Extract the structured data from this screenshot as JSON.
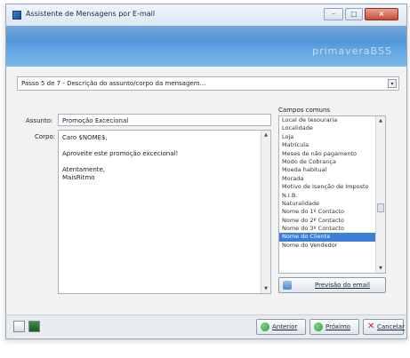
{
  "window": {
    "title": "Assistente de Mensagens por E-mail",
    "controls": {
      "minimize": "–",
      "maximize": "□",
      "close": "×"
    }
  },
  "banner": {
    "brand": "primaveraBSS"
  },
  "step": {
    "value": "Passo 5 de 7 - Descrição do assunto/corpo da mensagem...",
    "dropdown_icon": "▾"
  },
  "form": {
    "subject_label": "Assunto:",
    "subject_value": "Promoção Excecional",
    "body_label": "Corpo:",
    "body_lines": [
      "Caro $NOME$,",
      "",
      "Aproveite este promoção excecional!",
      "",
      "Atentamente,",
      "MaisRitmo"
    ]
  },
  "fields": {
    "heading": "Campos comuns",
    "items": [
      "Local de tesouraria",
      "Localidade",
      "Loja",
      "Matrícula",
      "Meses de não pagamento",
      "Modo de Cobrança",
      "Moeda habitual",
      "Morada",
      "Motivo de Isenção de Imposto",
      "N.I.B.",
      "Naturalidade",
      "Nome do 1º Contacto",
      "Nome do 2º Contacto",
      "Nome do 3º Contacto",
      "Nome do Cliente",
      "Nome do Vendedor"
    ],
    "selected_index": 14,
    "preview_label": "Previsão do email"
  },
  "buttons": {
    "previous": "Anterior",
    "next": "Próximo",
    "cancel": "Cancelar"
  },
  "colors": {
    "accent": "#3d7fd6",
    "banner": "#4a90d9",
    "cancel_x": "#d12a1e",
    "nav_green": "#2e9b3a"
  }
}
